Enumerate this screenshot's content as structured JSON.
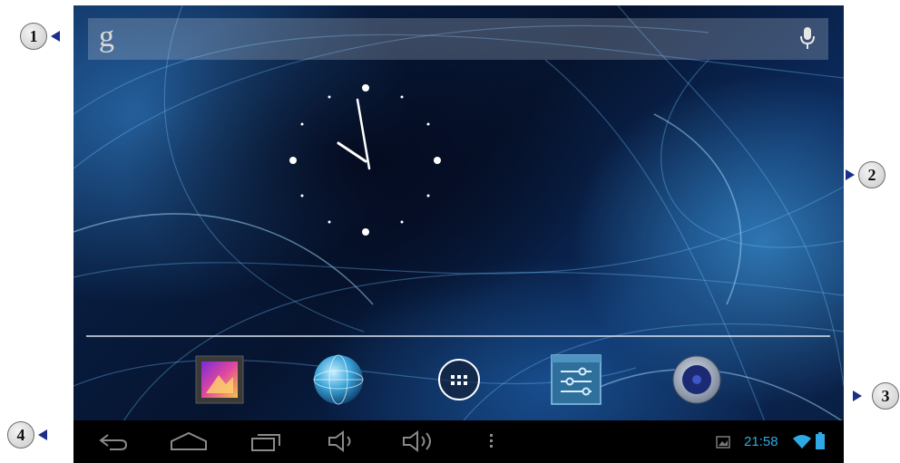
{
  "callouts": [
    "1",
    "2",
    "3",
    "4"
  ],
  "search": {
    "logo": "g",
    "left_icon": "google-g-icon",
    "right_icon": "microphone-icon"
  },
  "clock": {
    "type": "analog",
    "time": "21:58"
  },
  "dock": {
    "items": [
      {
        "name": "gallery",
        "icon": "gallery-icon"
      },
      {
        "name": "browser",
        "icon": "globe-icon"
      },
      {
        "name": "all-apps",
        "icon": "apps-grid-icon"
      },
      {
        "name": "settings",
        "icon": "settings-sliders-icon"
      },
      {
        "name": "music",
        "icon": "speaker-icon"
      }
    ]
  },
  "navbar": {
    "buttons": [
      "back-icon",
      "home-icon",
      "recent-apps-icon",
      "volume-down-icon",
      "volume-up-icon",
      "menu-icon"
    ],
    "status": {
      "time": "21:58",
      "icons": [
        "screenshot-icon",
        "wifi-icon",
        "battery-icon"
      ]
    }
  },
  "colors": {
    "status_accent": "#2fa9e4",
    "callout_arrow": "#1a2e8a",
    "navbar": "#000000"
  }
}
